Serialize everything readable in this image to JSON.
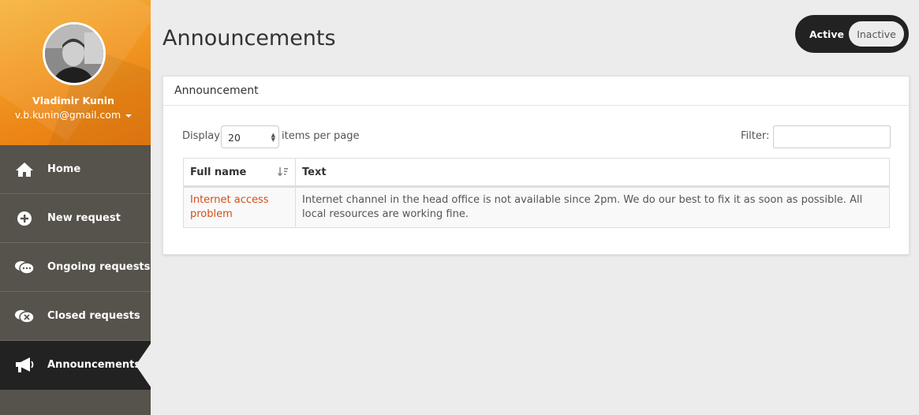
{
  "user": {
    "name": "Vladimir Kunin",
    "email": "v.b.kunin@gmail.com"
  },
  "nav": {
    "items": [
      {
        "label": "Home",
        "icon": "home-icon"
      },
      {
        "label": "New request",
        "icon": "plus-circle-icon"
      },
      {
        "label": "Ongoing requests",
        "icon": "chat-ellipsis-icon"
      },
      {
        "label": "Closed requests",
        "icon": "chat-close-icon"
      },
      {
        "label": "Announcements",
        "icon": "megaphone-icon",
        "active": true
      }
    ]
  },
  "page": {
    "title": "Announcements"
  },
  "toggle": {
    "active_label": "Active",
    "inactive_label": "Inactive"
  },
  "panel": {
    "title": "Announcement",
    "display_label": "Display",
    "page_size": "20",
    "per_page_label": "items per page",
    "filter_label": "Filter:",
    "filter_value": ""
  },
  "table": {
    "columns": [
      "Full name",
      "Text"
    ],
    "rows": [
      {
        "name": "Internet access problem",
        "text": "Internet channel in the head office is not available since 2pm. We do our best to fix it as soon as possible. All local resources are working fine."
      }
    ]
  },
  "colors": {
    "accent": "#d04e1a",
    "sidebar": "#56524c",
    "profile_orange": "#f29a24"
  }
}
